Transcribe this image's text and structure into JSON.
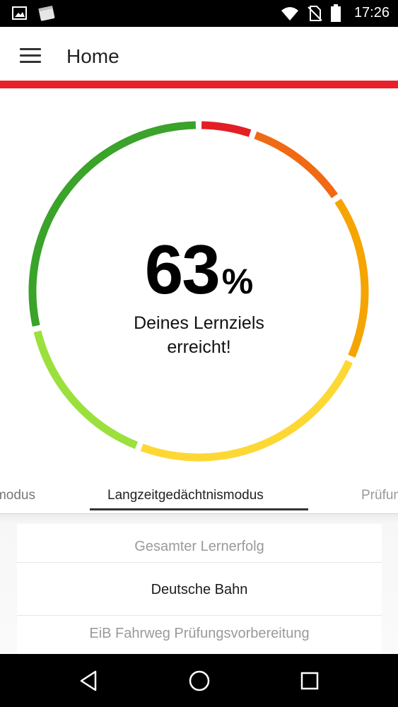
{
  "status_bar": {
    "time": "17:26",
    "icons": [
      "image-notification-icon",
      "stack-notification-icon",
      "wifi-icon",
      "no-sim-icon",
      "battery-icon"
    ]
  },
  "app_bar": {
    "title": "Home",
    "menu_icon": "hamburger-menu-icon",
    "accent_color": "#e8202a"
  },
  "progress": {
    "value_percent": 63,
    "number": "63",
    "percent_sign": "%",
    "label_line1": "Deines Lernziels",
    "label_line2": "erreicht!",
    "segment_colors": [
      "#e31e24",
      "#f06a14",
      "#f5a400",
      "#fdd835",
      "#9be03c",
      "#3aa32a"
    ]
  },
  "tabs": [
    {
      "label": "modus",
      "active": false
    },
    {
      "label": "Langzeitgedächtnismodus",
      "active": true
    },
    {
      "label": "Prüfung",
      "active": false
    }
  ],
  "list": {
    "items": [
      {
        "label": "Gesamter Lernerfolg",
        "dimmed": true
      },
      {
        "label": "Deutsche Bahn",
        "dimmed": false
      },
      {
        "label": "EiB Fahrweg Prüfungsvorbereitung",
        "dimmed": true
      }
    ]
  },
  "nav_bar": {
    "buttons": [
      "back-icon",
      "home-icon",
      "recents-icon"
    ]
  }
}
